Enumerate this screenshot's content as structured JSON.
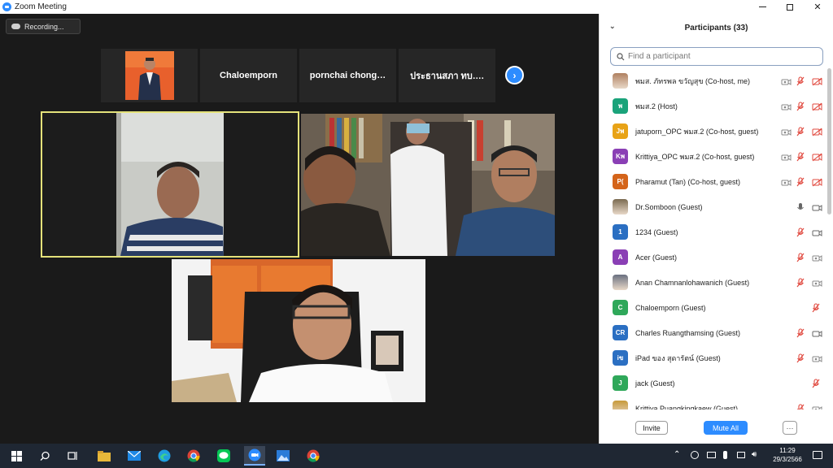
{
  "window": {
    "title": "Zoom Meeting"
  },
  "meeting": {
    "recording_label": "Recording...",
    "strip_tiles": [
      "Chaloemporn",
      "pornchai  chong…",
      "ประธานสภา  ทบ…."
    ]
  },
  "participants": {
    "header": "Participants (33)",
    "search_placeholder": "Find a participant",
    "list": [
      {
        "name": "พมส. ภัทรพล ขวัญสุข (Co-host, me)",
        "initials": "",
        "color": "#b08060",
        "photo": true,
        "icons": [
          "video-off",
          "mic-off",
          "record"
        ]
      },
      {
        "name": "พมส.2 (Host)",
        "initials": "พ",
        "color": "#1aa37a",
        "photo": false,
        "icons": [
          "video-off",
          "mic-off",
          "record"
        ]
      },
      {
        "name": "jatuporn_OPC พมส.2 (Co-host, guest)",
        "initials": "Jพ",
        "color": "#e8a317",
        "photo": false,
        "icons": [
          "video-off",
          "mic-off",
          "record"
        ]
      },
      {
        "name": "Krittiya_OPC พมส.2 (Co-host, guest)",
        "initials": "Kพ",
        "color": "#8a3fb5",
        "photo": false,
        "icons": [
          "video-off",
          "mic-off",
          "record"
        ]
      },
      {
        "name": "Pharamut (Tan) (Co-host, guest)",
        "initials": "P(",
        "color": "#d4641a",
        "photo": false,
        "icons": [
          "video-off",
          "mic-off",
          "record"
        ]
      },
      {
        "name": "Dr.Somboon (Guest)",
        "initials": "",
        "color": "#7a6a50",
        "photo": true,
        "icons": [
          "mic-on",
          "video-on"
        ]
      },
      {
        "name": "1234 (Guest)",
        "initials": "1",
        "color": "#2b6fc2",
        "photo": false,
        "icons": [
          "mic-off",
          "video-on"
        ]
      },
      {
        "name": "Acer (Guest)",
        "initials": "A",
        "color": "#8a3fb5",
        "photo": false,
        "icons": [
          "mic-off",
          "video-off"
        ]
      },
      {
        "name": "Anan Chamnanlohawanich (Guest)",
        "initials": "",
        "color": "#6a7080",
        "photo": true,
        "icons": [
          "mic-off",
          "video-off"
        ]
      },
      {
        "name": "Chaloemporn (Guest)",
        "initials": "C",
        "color": "#2fa85a",
        "photo": false,
        "icons": [
          "mic-off"
        ]
      },
      {
        "name": "Charles Ruangthamsing (Guest)",
        "initials": "CR",
        "color": "#2b6fc2",
        "photo": false,
        "icons": [
          "mic-off",
          "video-on"
        ]
      },
      {
        "name": "iPad ของ สุดารัตน์ (Guest)",
        "initials": "iข",
        "color": "#2b6fc2",
        "photo": false,
        "icons": [
          "mic-off",
          "video-off"
        ]
      },
      {
        "name": "jack (Guest)",
        "initials": "J",
        "color": "#2fa85a",
        "photo": false,
        "icons": [
          "mic-off"
        ]
      },
      {
        "name": "Krittiya Puangkingkaew (Guest)",
        "initials": "",
        "color": "#c79a3a",
        "photo": true,
        "icons": [
          "mic-off",
          "video-off"
        ]
      }
    ],
    "invite_label": "Invite",
    "mute_all_label": "Mute All",
    "more_label": "···"
  },
  "taskbar": {
    "time": "11:29",
    "date": "29/3/2566",
    "apps": [
      "windows-start",
      "search",
      "task-view",
      "file-explorer",
      "mail",
      "edge",
      "chrome",
      "line",
      "zoom",
      "photos",
      "chrome"
    ]
  },
  "colors": {
    "accent": "#2d8cff",
    "muted_red": "#e0483e",
    "active_speaker": "#e4e27a"
  }
}
